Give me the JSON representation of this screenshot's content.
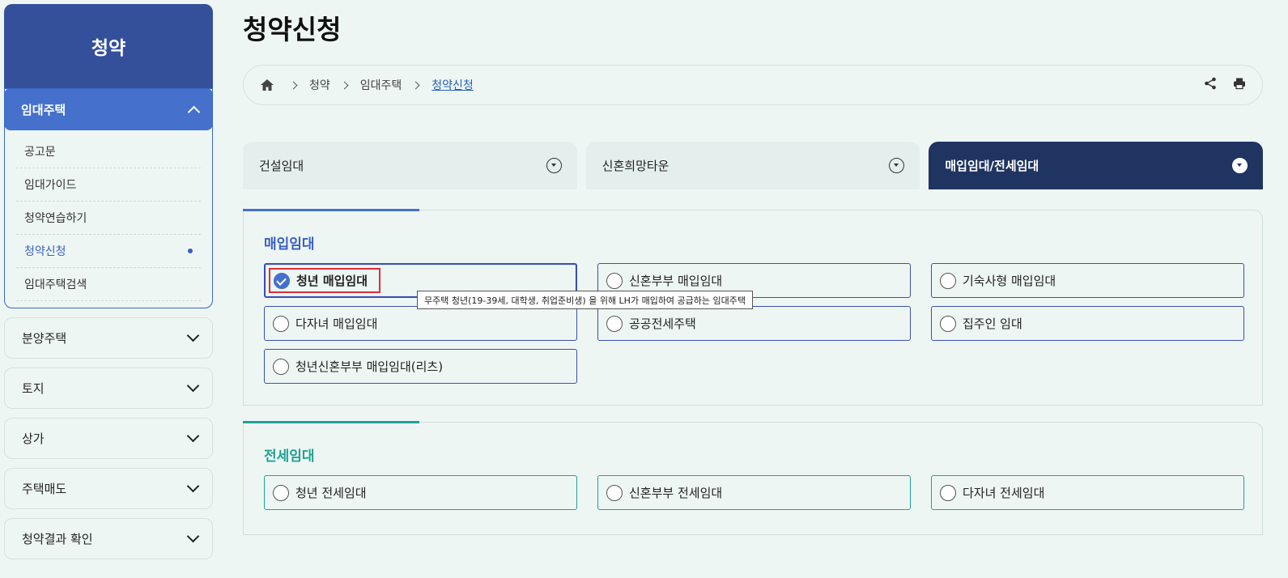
{
  "sidebar": {
    "title": "청약",
    "expanded_group": {
      "label": "임대주택",
      "items": [
        {
          "label": "공고문"
        },
        {
          "label": "임대가이드"
        },
        {
          "label": "청약연습하기"
        },
        {
          "label": "청약신청"
        },
        {
          "label": "임대주택검색"
        }
      ]
    },
    "groups": [
      {
        "label": "분양주택"
      },
      {
        "label": "토지"
      },
      {
        "label": "상가"
      },
      {
        "label": "주택매도"
      },
      {
        "label": "청약결과 확인"
      }
    ]
  },
  "page": {
    "title": "청약신청"
  },
  "breadcrumb": {
    "items": [
      "청약",
      "임대주택"
    ],
    "current": "청약신청"
  },
  "tabs": [
    {
      "label": "건설임대"
    },
    {
      "label": "신혼희망타운"
    },
    {
      "label": "매입임대/전세임대"
    }
  ],
  "sections": {
    "purchase": {
      "title": "매입임대",
      "accent": "#4570cc",
      "options": [
        {
          "label": "청년 매입임대"
        },
        {
          "label": "신혼부부 매입임대"
        },
        {
          "label": "기숙사형 매입임대"
        },
        {
          "label": "다자녀 매입임대"
        },
        {
          "label": "공공전세주택"
        },
        {
          "label": "집주인 임대"
        },
        {
          "label": "청년신혼부부 매입임대(리츠)"
        }
      ],
      "tooltip": "무주택 청년(19-39세, 대학생, 취업준비생) 을 위해 LH가 매입하여 공급하는 임대주택"
    },
    "jeonse": {
      "title": "전세임대",
      "accent": "#1fa294",
      "options": [
        {
          "label": "청년 전세임대"
        },
        {
          "label": "신혼부부 전세임대"
        },
        {
          "label": "다자녀 전세임대"
        }
      ]
    }
  },
  "colors": {
    "sidebar_header": "#34509a",
    "sidebar_active": "#4570cc",
    "tab_active": "#1f3461",
    "selection_highlight": "#e02d36"
  }
}
